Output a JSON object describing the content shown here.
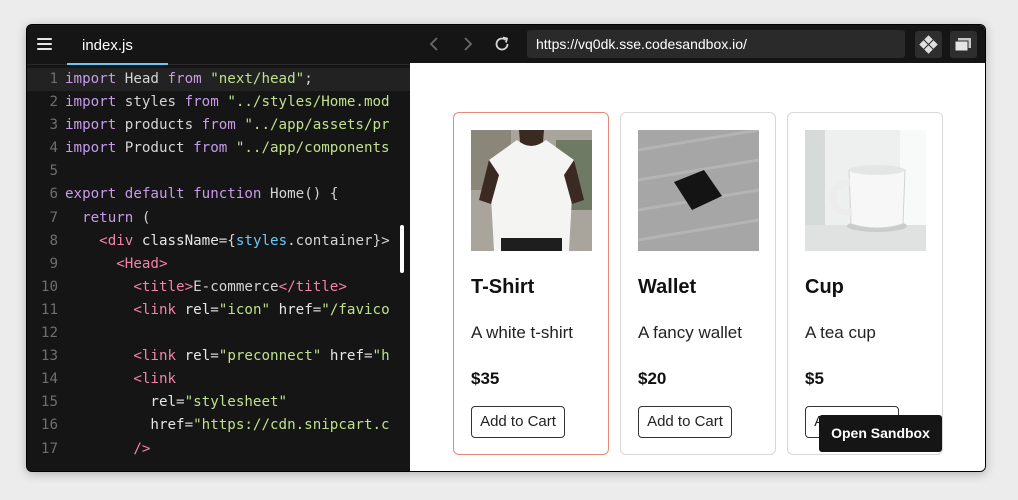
{
  "editor": {
    "tab_label": "index.js",
    "lines": [
      {
        "num": "1",
        "tokens": [
          [
            "kw",
            "import"
          ],
          [
            "pl",
            " Head "
          ],
          [
            "kw",
            "from"
          ],
          [
            "pl",
            " "
          ],
          [
            "str",
            "\"next/head\""
          ],
          [
            "pl",
            ";"
          ]
        ]
      },
      {
        "num": "2",
        "tokens": [
          [
            "kw",
            "import"
          ],
          [
            "pl",
            " styles "
          ],
          [
            "kw",
            "from"
          ],
          [
            "pl",
            " "
          ],
          [
            "str",
            "\"../styles/Home.mod"
          ]
        ]
      },
      {
        "num": "3",
        "tokens": [
          [
            "kw",
            "import"
          ],
          [
            "pl",
            " products "
          ],
          [
            "kw",
            "from"
          ],
          [
            "pl",
            " "
          ],
          [
            "str",
            "\"../app/assets/pr"
          ]
        ]
      },
      {
        "num": "4",
        "tokens": [
          [
            "kw",
            "import"
          ],
          [
            "pl",
            " Product "
          ],
          [
            "kw",
            "from"
          ],
          [
            "pl",
            " "
          ],
          [
            "str",
            "\"../app/components"
          ]
        ]
      },
      {
        "num": "5",
        "tokens": []
      },
      {
        "num": "6",
        "tokens": [
          [
            "kw",
            "export"
          ],
          [
            "pl",
            " "
          ],
          [
            "kw",
            "default"
          ],
          [
            "pl",
            " "
          ],
          [
            "kw",
            "function"
          ],
          [
            "pl",
            " Home() {"
          ]
        ]
      },
      {
        "num": "7",
        "tokens": [
          [
            "pl",
            "  "
          ],
          [
            "kw",
            "return"
          ],
          [
            "pl",
            " ("
          ]
        ]
      },
      {
        "num": "8",
        "tokens": [
          [
            "pl",
            "    "
          ],
          [
            "tag",
            "<div"
          ],
          [
            "pl",
            " "
          ],
          [
            "attr",
            "className"
          ],
          [
            "pl",
            "={"
          ],
          [
            "var",
            "styles"
          ],
          [
            "pl",
            ".container}>"
          ]
        ]
      },
      {
        "num": "9",
        "tokens": [
          [
            "pl",
            "      "
          ],
          [
            "tag",
            "<Head>"
          ]
        ]
      },
      {
        "num": "10",
        "tokens": [
          [
            "pl",
            "        "
          ],
          [
            "tag",
            "<title>"
          ],
          [
            "pl",
            "E-commerce"
          ],
          [
            "tag",
            "</title>"
          ]
        ]
      },
      {
        "num": "11",
        "tokens": [
          [
            "pl",
            "        "
          ],
          [
            "tag",
            "<link"
          ],
          [
            "pl",
            " "
          ],
          [
            "attr",
            "rel"
          ],
          [
            "pl",
            "="
          ],
          [
            "str",
            "\"icon\""
          ],
          [
            "pl",
            " "
          ],
          [
            "attr",
            "href"
          ],
          [
            "pl",
            "="
          ],
          [
            "str",
            "\"/favico"
          ]
        ]
      },
      {
        "num": "12",
        "tokens": []
      },
      {
        "num": "13",
        "tokens": [
          [
            "pl",
            "        "
          ],
          [
            "tag",
            "<link"
          ],
          [
            "pl",
            " "
          ],
          [
            "attr",
            "rel"
          ],
          [
            "pl",
            "="
          ],
          [
            "str",
            "\"preconnect\""
          ],
          [
            "pl",
            " "
          ],
          [
            "attr",
            "href"
          ],
          [
            "pl",
            "="
          ],
          [
            "str",
            "\"h"
          ]
        ]
      },
      {
        "num": "14",
        "tokens": [
          [
            "pl",
            "        "
          ],
          [
            "tag",
            "<link"
          ]
        ]
      },
      {
        "num": "15",
        "tokens": [
          [
            "pl",
            "          "
          ],
          [
            "attr",
            "rel"
          ],
          [
            "pl",
            "="
          ],
          [
            "str",
            "\"stylesheet\""
          ]
        ]
      },
      {
        "num": "16",
        "tokens": [
          [
            "pl",
            "          "
          ],
          [
            "attr",
            "href"
          ],
          [
            "pl",
            "="
          ],
          [
            "str",
            "\"https://cdn.snipcart.c"
          ]
        ]
      },
      {
        "num": "17",
        "tokens": [
          [
            "pl",
            "        "
          ],
          [
            "tag",
            "/>"
          ]
        ]
      }
    ]
  },
  "browser": {
    "url": "https://vq0dk.sse.codesandbox.io/"
  },
  "products": [
    {
      "name": "T-Shirt",
      "description": "A white t-shirt",
      "price": "$35",
      "button": "Add to Cart"
    },
    {
      "name": "Wallet",
      "description": "A fancy wallet",
      "price": "$20",
      "button": "Add to Cart"
    },
    {
      "name": "Cup",
      "description": "A tea cup",
      "price": "$5",
      "button": "Add to Cart"
    }
  ],
  "open_sandbox_label": "Open Sandbox",
  "colors": {
    "accent_tab": "#6cc7f6",
    "active_card_border": "#e8887a",
    "editor_bg": "#151515"
  }
}
